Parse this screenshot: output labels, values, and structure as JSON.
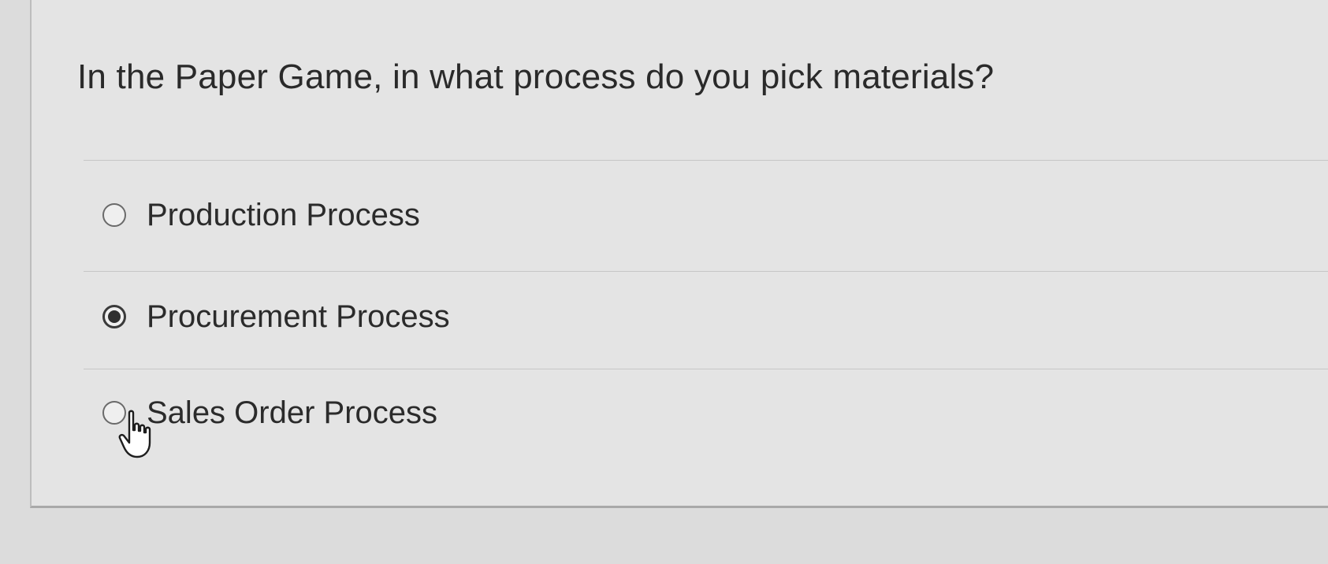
{
  "question": {
    "text": "In the Paper Game, in what process do you pick materials?"
  },
  "options": [
    {
      "label": "Production Process",
      "selected": false
    },
    {
      "label": "Procurement Process",
      "selected": true
    },
    {
      "label": "Sales Order Process",
      "selected": false
    }
  ],
  "cursor": {
    "icon": "hand-pointer-icon"
  }
}
